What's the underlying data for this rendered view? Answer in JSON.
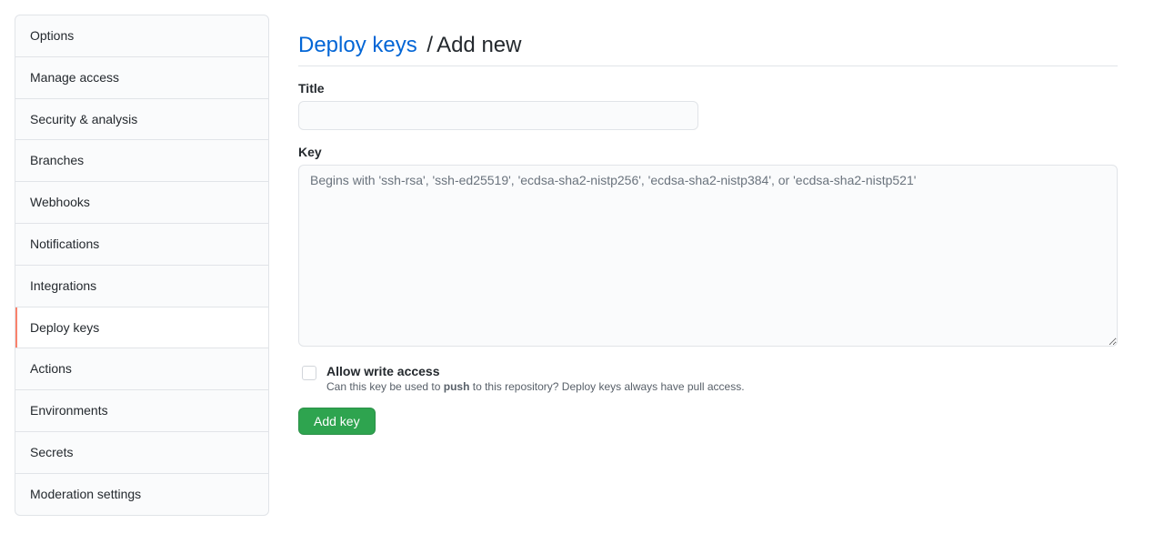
{
  "sidebar": {
    "items": [
      {
        "label": "Options",
        "name": "sidebar-item-options",
        "active": false
      },
      {
        "label": "Manage access",
        "name": "sidebar-item-manage-access",
        "active": false
      },
      {
        "label": "Security & analysis",
        "name": "sidebar-item-security-analysis",
        "active": false
      },
      {
        "label": "Branches",
        "name": "sidebar-item-branches",
        "active": false
      },
      {
        "label": "Webhooks",
        "name": "sidebar-item-webhooks",
        "active": false
      },
      {
        "label": "Notifications",
        "name": "sidebar-item-notifications",
        "active": false
      },
      {
        "label": "Integrations",
        "name": "sidebar-item-integrations",
        "active": false
      },
      {
        "label": "Deploy keys",
        "name": "sidebar-item-deploy-keys",
        "active": true
      },
      {
        "label": "Actions",
        "name": "sidebar-item-actions",
        "active": false
      },
      {
        "label": "Environments",
        "name": "sidebar-item-environments",
        "active": false
      },
      {
        "label": "Secrets",
        "name": "sidebar-item-secrets",
        "active": false
      },
      {
        "label": "Moderation settings",
        "name": "sidebar-item-moderation-settings",
        "active": false
      }
    ]
  },
  "header": {
    "breadcrumb_link": "Deploy keys",
    "breadcrumb_sep": "/",
    "breadcrumb_current": "Add new"
  },
  "form": {
    "title_label": "Title",
    "title_value": "",
    "key_label": "Key",
    "key_value": "",
    "key_placeholder": "Begins with 'ssh-rsa', 'ssh-ed25519', 'ecdsa-sha2-nistp256', 'ecdsa-sha2-nistp384', or 'ecdsa-sha2-nistp521'",
    "write_access_label": "Allow write access",
    "write_access_hint_pre": "Can this key be used to ",
    "write_access_hint_strong": "push",
    "write_access_hint_post": " to this repository? Deploy keys always have pull access.",
    "submit_label": "Add key"
  },
  "colors": {
    "link": "#0366d6",
    "primary_button": "#2ea44f",
    "active_indicator": "#f9826c"
  }
}
